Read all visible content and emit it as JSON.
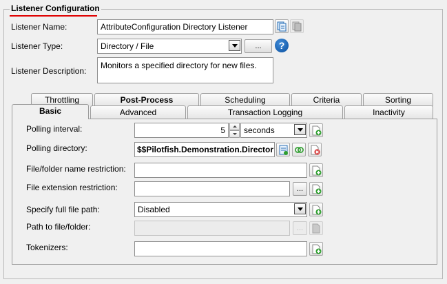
{
  "section": {
    "title": "Listener Configuration"
  },
  "listener": {
    "name_label": "Listener Name:",
    "name_value": "AttributeConfiguration Directory Listener",
    "type_label": "Listener Type:",
    "type_value": "Directory / File",
    "type_browse_label": "...",
    "help_label": "?",
    "description_label": "Listener Description:",
    "description_value": "Monitors a specified directory for new files."
  },
  "tabs": {
    "row_top": [
      "Throttling",
      "Post-Process",
      "Scheduling",
      "Criteria",
      "Sorting"
    ],
    "row_bottom": [
      "Basic",
      "Advanced",
      "Transaction Logging",
      "Inactivity"
    ],
    "active": "Basic"
  },
  "basic": {
    "polling_interval_label": "Polling interval:",
    "polling_interval_value": "5",
    "polling_interval_unit": "seconds",
    "polling_directory_label": "Polling directory:",
    "polling_directory_value": "$$Pilotfish.Demonstration.Director",
    "name_restriction_label": "File/folder name restriction:",
    "name_restriction_value": "",
    "extension_restriction_label": "File extension restriction:",
    "extension_restriction_value": "",
    "extension_browse_label": "...",
    "full_path_label": "Specify full file path:",
    "full_path_value": "Disabled",
    "path_label": "Path to file/folder:",
    "path_value": "",
    "path_browse_label": "...",
    "tokenizers_label": "Tokenizers:",
    "tokenizers_value": ""
  },
  "colors": {
    "accent_underline": "#e00000",
    "help_blue": "#1565c0",
    "add_green": "#2e9e2e",
    "remove_red": "#d32f2f"
  }
}
